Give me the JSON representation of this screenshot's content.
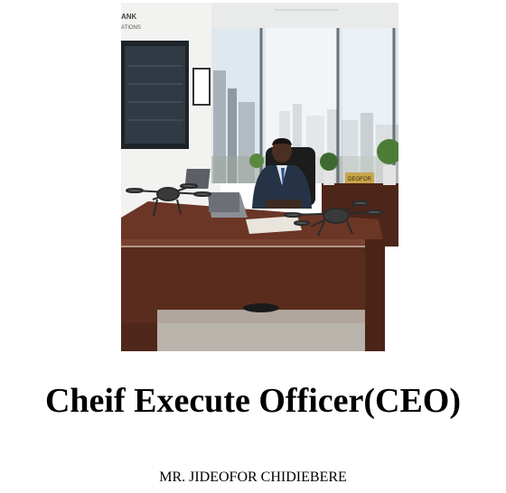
{
  "page": {
    "title": "Cheif Execute Officer(CEO)",
    "name": "MR. JIDEOFOR CHIDIEBERE"
  },
  "photo": {
    "wall_sign_text": "ANK\nATIONS",
    "desk_nameplate_text": "DEOFOR",
    "colors": {
      "desk": "#5a2c1e",
      "desk_top": "#6b3626",
      "floor": "#b9b4ab",
      "window_sky": "#dfe8ef",
      "wall": "#f2f2f0"
    }
  }
}
